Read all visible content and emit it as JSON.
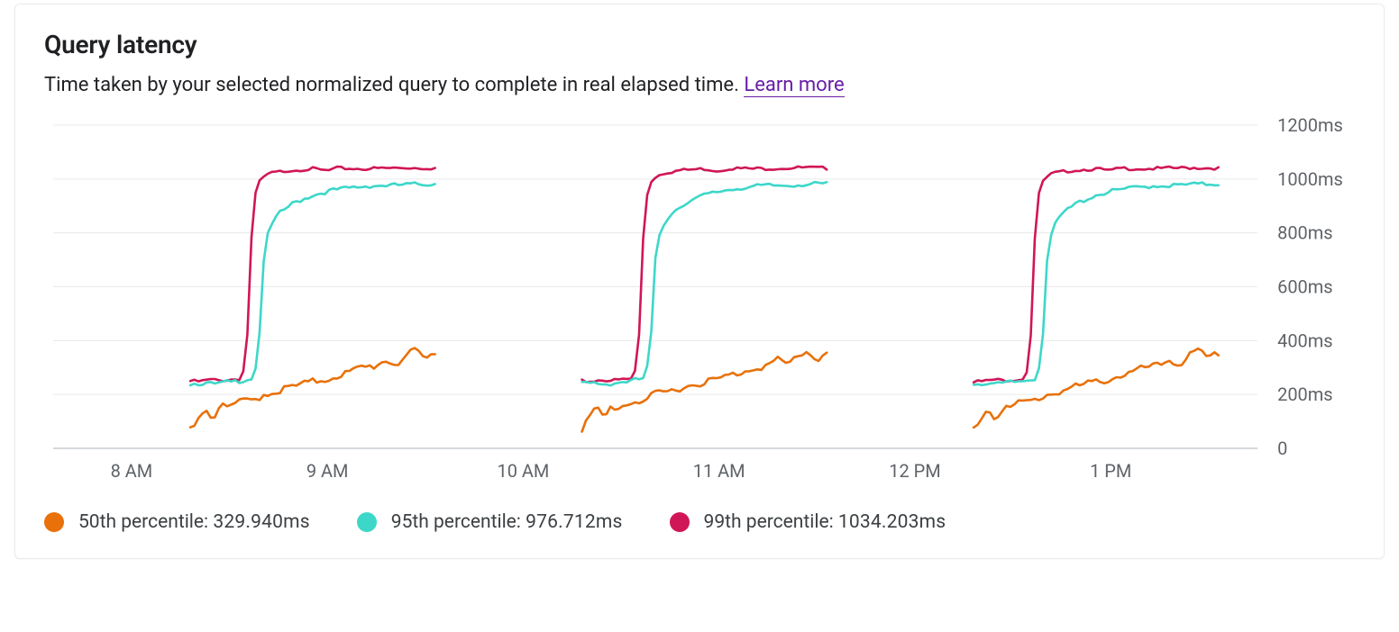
{
  "card": {
    "title": "Query latency",
    "subtitle_text": "Time taken by your selected normalized query to complete in real elapsed time. ",
    "learn_more": "Learn more"
  },
  "colors": {
    "p50": "#e8710a",
    "p95": "#3dd7c9",
    "p99": "#d01657",
    "grid": "#e8eaed",
    "axis": "#5f6368"
  },
  "legend": {
    "p50_label": "50th percentile:",
    "p50_value": "329.940ms",
    "p95_label": "95th percentile:",
    "p95_value": "976.712ms",
    "p99_label": "99th percentile:",
    "p99_value": "1034.203ms"
  },
  "chart_data": {
    "type": "line",
    "title": "Query latency",
    "xlabel": "",
    "ylabel": "",
    "ylim": [
      0,
      1200
    ],
    "y_unit": "ms",
    "y_ticks": [
      0,
      200,
      400,
      600,
      800,
      1000,
      1200
    ],
    "x_ticks": [
      "8 AM",
      "9 AM",
      "10 AM",
      "11 AM",
      "12 PM",
      "1 PM"
    ],
    "x_domain_hours": [
      7.6,
      13.75
    ],
    "legend_position": "bottom",
    "segments": [
      {
        "start_hour": 8.3,
        "end_hour": 9.55
      },
      {
        "start_hour": 10.3,
        "end_hour": 11.55
      },
      {
        "start_hour": 12.3,
        "end_hour": 13.55
      }
    ],
    "series": [
      {
        "name": "99th percentile",
        "color_key": "p99",
        "archetype": [
          {
            "t": 0.0,
            "v": 250
          },
          {
            "t": 0.04,
            "v": 248
          },
          {
            "t": 0.08,
            "v": 255
          },
          {
            "t": 0.12,
            "v": 252
          },
          {
            "t": 0.16,
            "v": 255
          },
          {
            "t": 0.2,
            "v": 258
          },
          {
            "t": 0.225,
            "v": 300
          },
          {
            "t": 0.24,
            "v": 520
          },
          {
            "t": 0.25,
            "v": 780
          },
          {
            "t": 0.26,
            "v": 920
          },
          {
            "t": 0.28,
            "v": 990
          },
          {
            "t": 0.32,
            "v": 1020
          },
          {
            "t": 0.4,
            "v": 1032
          },
          {
            "t": 0.5,
            "v": 1038
          },
          {
            "t": 0.56,
            "v": 1030
          },
          {
            "t": 0.6,
            "v": 1040
          },
          {
            "t": 0.7,
            "v": 1038
          },
          {
            "t": 0.8,
            "v": 1040
          },
          {
            "t": 0.9,
            "v": 1042
          },
          {
            "t": 1.0,
            "v": 1040
          }
        ]
      },
      {
        "name": "95th percentile",
        "color_key": "p95",
        "archetype": [
          {
            "t": 0.0,
            "v": 240
          },
          {
            "t": 0.05,
            "v": 242
          },
          {
            "t": 0.1,
            "v": 238
          },
          {
            "t": 0.15,
            "v": 245
          },
          {
            "t": 0.2,
            "v": 250
          },
          {
            "t": 0.25,
            "v": 260
          },
          {
            "t": 0.275,
            "v": 320
          },
          {
            "t": 0.29,
            "v": 520
          },
          {
            "t": 0.3,
            "v": 700
          },
          {
            "t": 0.32,
            "v": 810
          },
          {
            "t": 0.36,
            "v": 870
          },
          {
            "t": 0.42,
            "v": 910
          },
          {
            "t": 0.5,
            "v": 940
          },
          {
            "t": 0.58,
            "v": 958
          },
          {
            "t": 0.66,
            "v": 968
          },
          {
            "t": 0.74,
            "v": 975
          },
          {
            "t": 0.82,
            "v": 976
          },
          {
            "t": 0.9,
            "v": 980
          },
          {
            "t": 1.0,
            "v": 982
          }
        ]
      },
      {
        "name": "50th percentile",
        "color_key": "p50",
        "archetype": [
          {
            "t": 0.0,
            "v": 70
          },
          {
            "t": 0.03,
            "v": 115
          },
          {
            "t": 0.06,
            "v": 150
          },
          {
            "t": 0.09,
            "v": 110
          },
          {
            "t": 0.12,
            "v": 155
          },
          {
            "t": 0.15,
            "v": 150
          },
          {
            "t": 0.18,
            "v": 165
          },
          {
            "t": 0.22,
            "v": 175
          },
          {
            "t": 0.26,
            "v": 180
          },
          {
            "t": 0.3,
            "v": 200
          },
          {
            "t": 0.35,
            "v": 210
          },
          {
            "t": 0.4,
            "v": 225
          },
          {
            "t": 0.45,
            "v": 235
          },
          {
            "t": 0.5,
            "v": 248
          },
          {
            "t": 0.55,
            "v": 255
          },
          {
            "t": 0.6,
            "v": 270
          },
          {
            "t": 0.65,
            "v": 282
          },
          {
            "t": 0.7,
            "v": 300
          },
          {
            "t": 0.75,
            "v": 305
          },
          {
            "t": 0.8,
            "v": 328
          },
          {
            "t": 0.84,
            "v": 310
          },
          {
            "t": 0.88,
            "v": 345
          },
          {
            "t": 0.92,
            "v": 360
          },
          {
            "t": 0.96,
            "v": 330
          },
          {
            "t": 1.0,
            "v": 355
          }
        ]
      }
    ]
  }
}
